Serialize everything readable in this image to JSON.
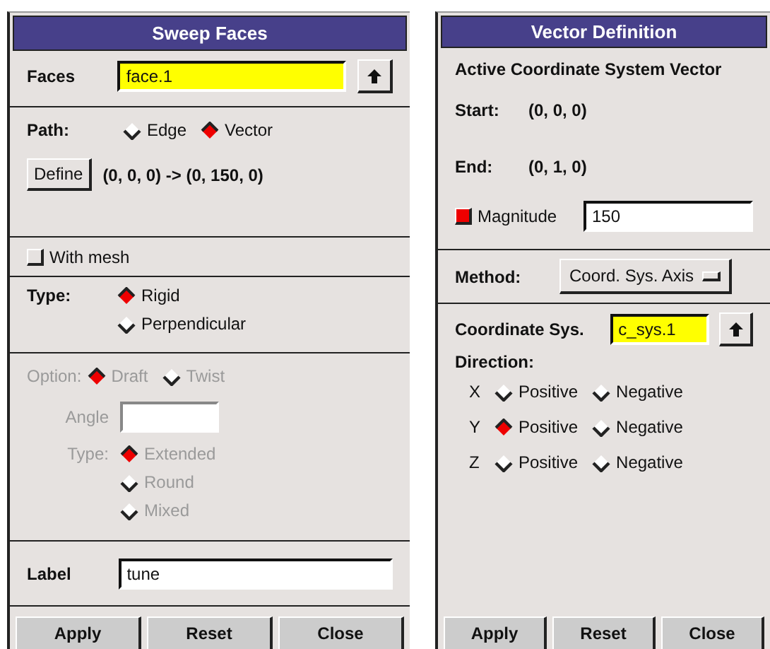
{
  "sweep_faces": {
    "title": "Sweep Faces",
    "faces": {
      "label": "Faces",
      "value": "face.1"
    },
    "path": {
      "label": "Path:",
      "options": [
        {
          "label": "Edge",
          "selected": false
        },
        {
          "label": "Vector",
          "selected": true
        }
      ]
    },
    "define_button": "Define",
    "vector_text": "(0, 0, 0) -> (0, 150, 0)",
    "with_mesh": {
      "label": "With mesh",
      "checked": false
    },
    "type": {
      "label": "Type:",
      "options": [
        {
          "label": "Rigid",
          "selected": true
        },
        {
          "label": "Perpendicular",
          "selected": false
        }
      ]
    },
    "option": {
      "label": "Option:",
      "disabled": true,
      "options": [
        {
          "label": "Draft",
          "selected": true
        },
        {
          "label": "Twist",
          "selected": false
        }
      ]
    },
    "angle": {
      "label": "Angle",
      "disabled": true
    },
    "subtype": {
      "label": "Type:",
      "disabled": true,
      "options": [
        {
          "label": "Extended",
          "selected": true
        },
        {
          "label": "Round",
          "selected": false
        },
        {
          "label": "Mixed",
          "selected": false
        }
      ]
    },
    "label_field": {
      "label": "Label",
      "value": "tune"
    },
    "buttons": [
      "Apply",
      "Reset",
      "Close"
    ]
  },
  "vector_definition": {
    "title": "Vector Definition",
    "heading": "Active Coordinate System Vector",
    "start": {
      "label": "Start:",
      "value": "(0, 0, 0)"
    },
    "end": {
      "label": "End:",
      "value": "(0, 1, 0)"
    },
    "magnitude": {
      "label": "Magnitude",
      "checked": true,
      "value": "150"
    },
    "method": {
      "label": "Method:",
      "value": "Coord. Sys. Axis"
    },
    "coordinate_sys": {
      "label": "Coordinate Sys.",
      "value": "c_sys.1"
    },
    "direction": {
      "label": "Direction:",
      "axes": [
        {
          "axis": "X",
          "options": [
            {
              "label": "Positive",
              "selected": false
            },
            {
              "label": "Negative",
              "selected": false
            }
          ]
        },
        {
          "axis": "Y",
          "options": [
            {
              "label": "Positive",
              "selected": true
            },
            {
              "label": "Negative",
              "selected": false
            }
          ]
        },
        {
          "axis": "Z",
          "options": [
            {
              "label": "Positive",
              "selected": false
            },
            {
              "label": "Negative",
              "selected": false
            }
          ]
        }
      ]
    },
    "buttons": [
      "Apply",
      "Reset",
      "Close"
    ]
  }
}
